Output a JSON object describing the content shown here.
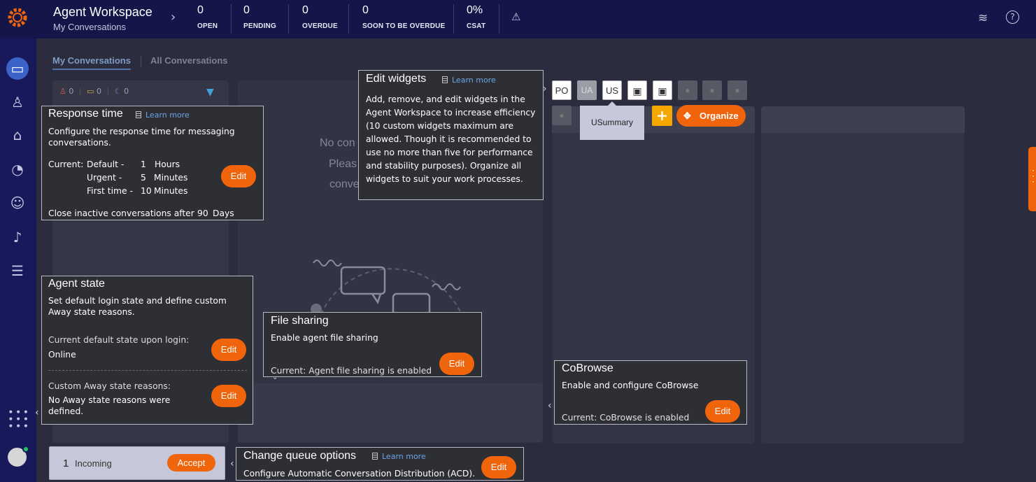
{
  "header": {
    "title": "Agent Workspace",
    "subtitle": "My Conversations",
    "stats": [
      {
        "value": "0",
        "label": "OPEN"
      },
      {
        "value": "0",
        "label": "PENDING"
      },
      {
        "value": "0",
        "label": "OVERDUE"
      },
      {
        "value": "0",
        "label": "SOON TO BE OVERDUE"
      },
      {
        "value": "0%",
        "label": "CSAT"
      }
    ]
  },
  "tabs": {
    "my": "My Conversations",
    "all": "All Conversations"
  },
  "conv_list": {
    "alerts": "0",
    "messages": "0",
    "snoozed": "0"
  },
  "center": {
    "line1": "No con",
    "line2": "Pleas",
    "line3": "conve"
  },
  "widgets": {
    "buttons": [
      "PO",
      "UA",
      "US"
    ],
    "tooltip": "USummary",
    "organize": "Organize",
    "add": "+"
  },
  "incoming": {
    "count": "1",
    "label": "Incoming",
    "accept": "Accept"
  },
  "cards": {
    "response_time": {
      "title": "Response time",
      "learn": "Learn more",
      "desc": "Configure the response time for messaging conversations.",
      "current_label": "Current:",
      "rows": [
        {
          "name": "Default -",
          "value": "1",
          "unit": "Hours"
        },
        {
          "name": "Urgent -",
          "value": "5",
          "unit": "Minutes"
        },
        {
          "name": "First time -",
          "value": "10",
          "unit": "Minutes"
        }
      ],
      "close_text": "Close inactive conversations after",
      "close_value": "90",
      "close_unit": "Days",
      "edit": "Edit"
    },
    "edit_widgets": {
      "title": "Edit widgets",
      "learn": "Learn more",
      "text": "Add, remove, and edit widgets in the Agent Workspace to increase efficiency (10 custom widgets maximum are allowed. Though it is recommended to use no more than five for performance and stability purposes). Organize all widgets to suit your work processes."
    },
    "agent_state": {
      "title": "Agent state",
      "desc": "Set default login state and define custom Away state reasons.",
      "default_label": "Current default state upon login:",
      "default_value": "Online",
      "away_label": "Custom Away state reasons:",
      "away_value": "No Away state reasons were defined.",
      "edit": "Edit"
    },
    "file_sharing": {
      "title": "File sharing",
      "desc": "Enable agent file sharing",
      "current": "Current: Agent file sharing is enabled",
      "edit": "Edit"
    },
    "cobrowse": {
      "title": "CoBrowse",
      "desc": "Enable and configure CoBrowse",
      "current": "Current: CoBrowse is enabled",
      "edit": "Edit"
    },
    "queue": {
      "title": "Change queue options",
      "learn": "Learn more",
      "desc": "Configure Automatic Conversation Distribution (ACD).",
      "edit": "Edit"
    }
  },
  "colors": {
    "accent": "#f0640b",
    "navbar": "#14164a",
    "sidebar": "#17195a",
    "link": "#6aa4e6"
  }
}
